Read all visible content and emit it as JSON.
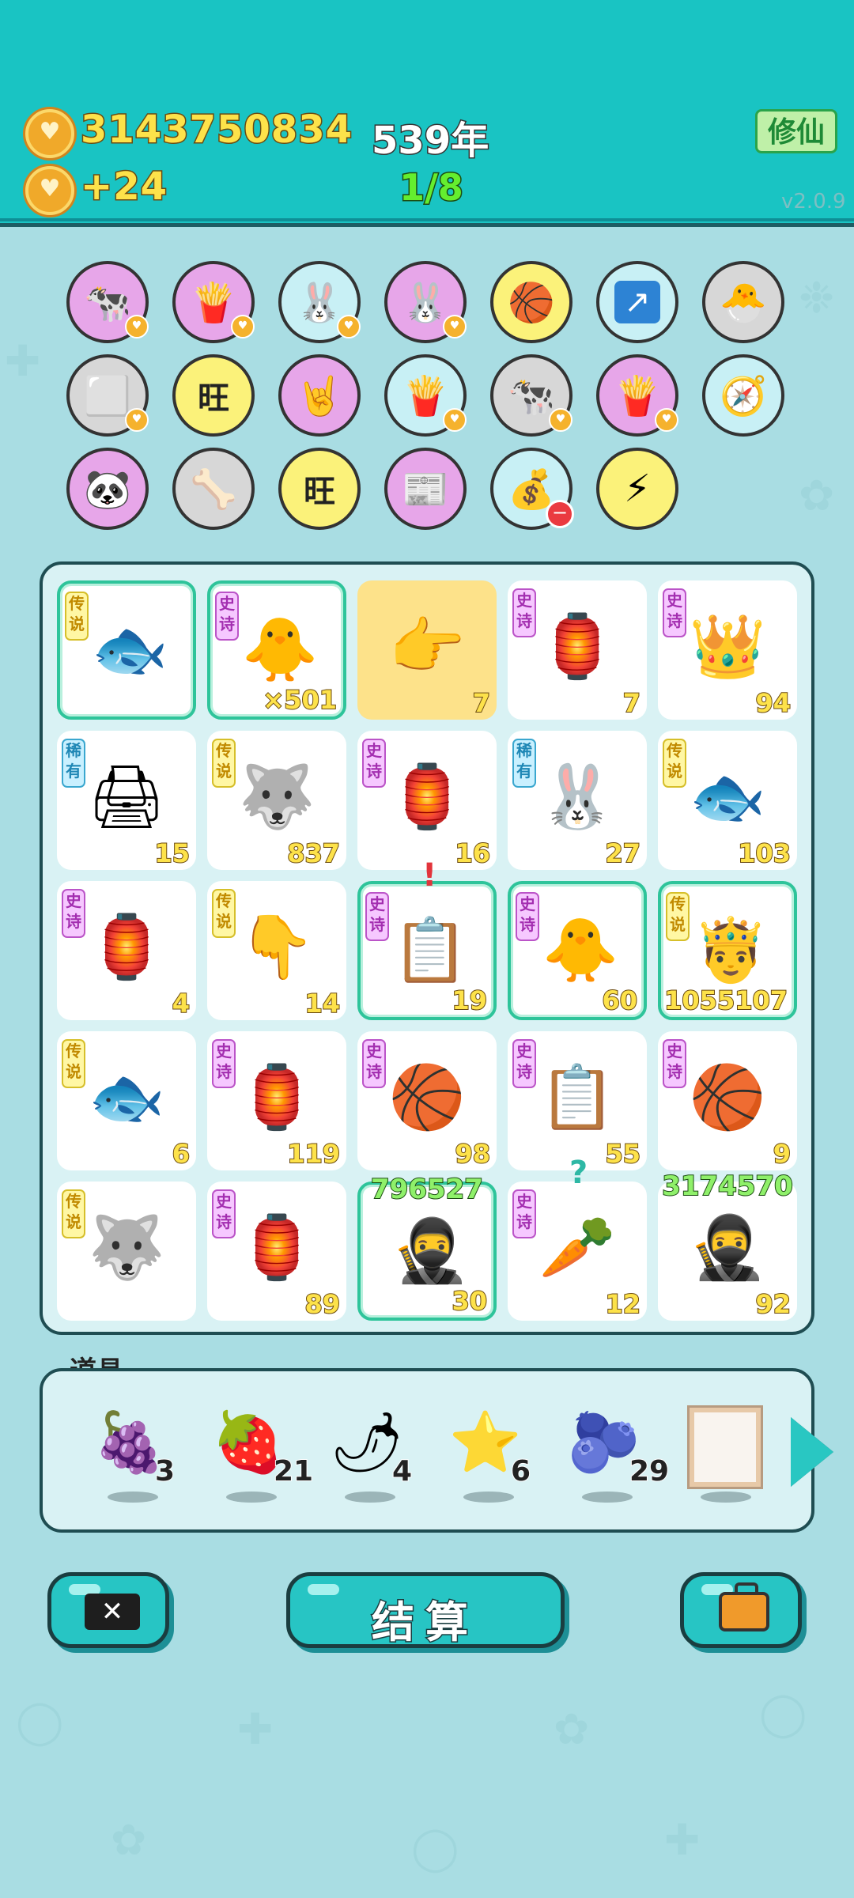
{
  "header": {
    "coins": "3143750834",
    "income": "+24",
    "year": "539年",
    "round": "1/8",
    "cultivate_label": "修仙",
    "version": "v2.0.9"
  },
  "symbols": [
    {
      "icon": "🐄",
      "bg": "#e7a6e9",
      "heart": true
    },
    {
      "icon": "🍟",
      "bg": "#e7a6e9",
      "heart": true
    },
    {
      "icon": "🐰",
      "bg": "#c8f0f5",
      "heart": true
    },
    {
      "icon": "🐰",
      "bg": "#e7a6e9",
      "heart": true
    },
    {
      "icon": "🏀",
      "bg": "#fbf27a",
      "heart": false
    },
    {
      "icon": "↗",
      "bg": "#c8f0f5",
      "heart": false
    },
    {
      "icon": "🐣",
      "bg": "#d7d7d7",
      "heart": false
    },
    {
      "icon": "⬜",
      "bg": "#d7d7d7",
      "heart": true
    },
    {
      "icon": "旺",
      "bg": "#fbf27a",
      "heart": false
    },
    {
      "icon": "🤘",
      "bg": "#e7a6e9",
      "heart": false
    },
    {
      "icon": "🍟",
      "bg": "#c8f0f5",
      "heart": true
    },
    {
      "icon": "🐄",
      "bg": "#d7d7d7",
      "heart": true
    },
    {
      "icon": "🍟",
      "bg": "#e7a6e9",
      "heart": true
    },
    {
      "icon": "🧭",
      "bg": "#c8f0f5",
      "heart": false
    },
    {
      "icon": "🐼",
      "bg": "#e7a6e9",
      "heart": false
    },
    {
      "icon": "🦴",
      "bg": "#d7d7d7",
      "heart": false
    },
    {
      "icon": "旺",
      "bg": "#fbf27a",
      "heart": false
    },
    {
      "icon": "📰",
      "bg": "#e7a6e9",
      "heart": false
    },
    {
      "icon": "💰",
      "bg": "#c8f0f5",
      "heart": false,
      "minus": true
    },
    {
      "icon": "⚡",
      "bg": "#fbf27a",
      "heart": false
    }
  ],
  "board": {
    "cells": [
      {
        "badge": "传说",
        "tier": "legend",
        "icon": "🐟",
        "value": "",
        "hl": true
      },
      {
        "badge": "史诗",
        "tier": "epic",
        "icon": "🐥",
        "value": "×501",
        "hl": true
      },
      {
        "badge": "",
        "tier": "",
        "icon": "👉",
        "value": "7",
        "yellow": true
      },
      {
        "badge": "史诗",
        "tier": "epic",
        "icon": "🏮",
        "value": "7"
      },
      {
        "badge": "史诗",
        "tier": "epic",
        "icon": "👑",
        "value": "94"
      },
      {
        "badge": "稀有",
        "tier": "rare",
        "icon": "🖨",
        "value": "15"
      },
      {
        "badge": "传说",
        "tier": "legend",
        "icon": "🐺",
        "value": "837"
      },
      {
        "badge": "史诗",
        "tier": "epic",
        "icon": "🏮",
        "value": "16"
      },
      {
        "badge": "稀有",
        "tier": "rare",
        "icon": "🐰",
        "value": "27"
      },
      {
        "badge": "传说",
        "tier": "legend",
        "icon": "🐟",
        "value": "103"
      },
      {
        "badge": "史诗",
        "tier": "epic",
        "icon": "🏮",
        "value": "4"
      },
      {
        "badge": "传说",
        "tier": "legend",
        "icon": "👇",
        "value": "14"
      },
      {
        "badge": "史诗",
        "tier": "epic",
        "icon": "📋",
        "value": "19",
        "hl": true,
        "alert": "!"
      },
      {
        "badge": "史诗",
        "tier": "epic",
        "icon": "🐥",
        "value": "60",
        "hl": true
      },
      {
        "badge": "传说",
        "tier": "legend",
        "icon": "🤴",
        "value": "1055107",
        "hl": true
      },
      {
        "badge": "传说",
        "tier": "legend",
        "icon": "🐟",
        "value": "6"
      },
      {
        "badge": "史诗",
        "tier": "epic",
        "icon": "🏮",
        "value": "119"
      },
      {
        "badge": "史诗",
        "tier": "epic",
        "icon": "🏀",
        "value": "98"
      },
      {
        "badge": "史诗",
        "tier": "epic",
        "icon": "📋",
        "value": "55"
      },
      {
        "badge": "史诗",
        "tier": "epic",
        "icon": "🏀",
        "value": "9"
      },
      {
        "badge": "传说",
        "tier": "legend",
        "icon": "🐺",
        "value": ""
      },
      {
        "badge": "史诗",
        "tier": "epic",
        "icon": "🏮",
        "value": "89"
      },
      {
        "badge": "",
        "tier": "",
        "icon": "🥷",
        "value": "30",
        "hl": true,
        "top": "796527"
      },
      {
        "badge": "史诗",
        "tier": "epic",
        "icon": "🥕",
        "value": "12",
        "alert": "?"
      },
      {
        "badge": "",
        "tier": "",
        "icon": "🥷",
        "value": "92",
        "top": "3174570"
      }
    ]
  },
  "items": {
    "label": "道具",
    "list": [
      {
        "icon": "🍇",
        "count": "3"
      },
      {
        "icon": "🍓",
        "count": "21"
      },
      {
        "icon": "🌶",
        "count": "4"
      },
      {
        "icon": "⭐",
        "count": "6"
      },
      {
        "icon": "🫐",
        "count": "29"
      },
      {
        "icon": "frame",
        "count": ""
      }
    ]
  },
  "buttons": {
    "skip_label": "✕",
    "settle_label": "结算"
  },
  "colors": {
    "header_bg": "#19c4c3",
    "page_bg": "#a9dde3",
    "highlight": "#2ec49a",
    "number_yellow": "#fde24a"
  }
}
